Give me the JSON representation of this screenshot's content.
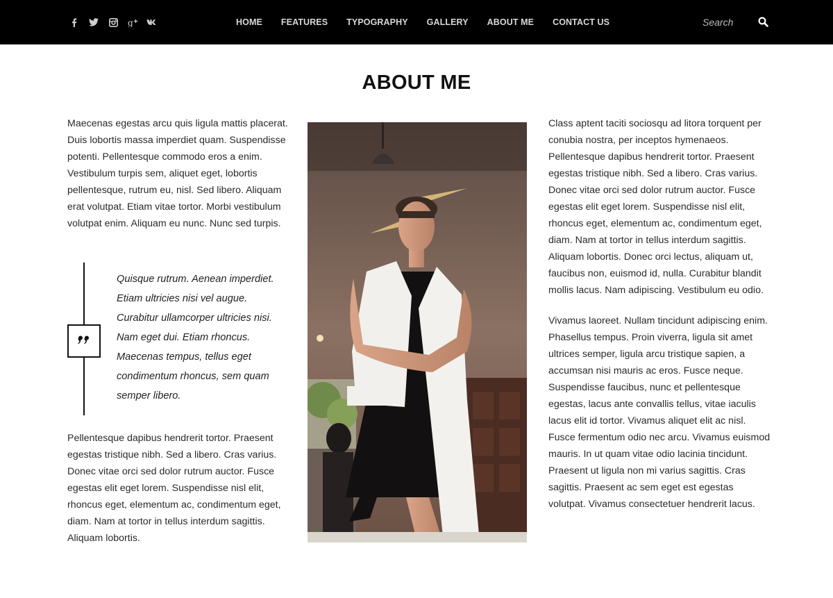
{
  "header": {
    "social": [
      {
        "name": "facebook-icon"
      },
      {
        "name": "twitter-icon"
      },
      {
        "name": "instagram-icon"
      },
      {
        "name": "google-plus-icon"
      },
      {
        "name": "vk-icon"
      }
    ],
    "nav": [
      {
        "label": "HOME"
      },
      {
        "label": "FEATURES"
      },
      {
        "label": "TYPOGRAPHY"
      },
      {
        "label": "GALLERY"
      },
      {
        "label": "ABOUT ME"
      },
      {
        "label": "CONTACT US"
      }
    ],
    "search": {
      "placeholder": "Search",
      "icon": "search-icon"
    }
  },
  "page": {
    "title": "ABOUT ME",
    "left_paragraph_1": "Maecenas egestas arcu quis ligula mattis placerat. Duis lobortis massa imperdiet quam. Suspendisse potenti. Pellentesque commodo eros a enim. Vestibulum turpis sem, aliquet eget, lobortis pellentesque, rutrum eu, nisl. Sed libero. Aliquam erat volutpat. Etiam vitae tortor. Morbi vestibulum volutpat enim. Aliquam eu nunc. Nunc sed turpis.",
    "quote": "Quisque rutrum. Aenean imperdiet. Etiam ultricies nisi vel augue. Curabitur ullamcorper ultricies nisi. Nam eget dui. Etiam rhoncus. Maecenas tempus, tellus eget condimentum rhoncus, sem quam semper libero.",
    "left_paragraph_2": "Pellentesque dapibus hendrerit tortor. Praesent egestas tristique nibh. Sed a libero. Cras varius. Donec vitae orci sed dolor rutrum auctor. Fusce egestas elit eget lorem. Suspendisse nisl elit, rhoncus eget, elementum ac, condimentum eget, diam. Nam at tortor in tellus interdum sagittis. Aliquam lobortis.",
    "right_paragraph_1": "Class aptent taciti sociosqu ad litora torquent per conubia nostra, per inceptos hymenaeos. Pellentesque dapibus hendrerit tortor. Praesent egestas tristique nibh. Sed a libero. Cras varius. Donec vitae orci sed dolor rutrum auctor. Fusce egestas elit eget lorem. Suspendisse nisl elit, rhoncus eget, elementum ac, condimentum eget, diam. Nam at tortor in tellus interdum sagittis. Aliquam lobortis. Donec orci lectus, aliquam ut, faucibus non, euismod id, nulla. Curabitur blandit mollis lacus. Nam adipiscing. Vestibulum eu odio.",
    "right_paragraph_2": "Vivamus laoreet. Nullam tincidunt adipiscing enim. Phasellus tempus. Proin viverra, ligula sit amet ultrices semper, ligula arcu tristique sapien, a accumsan nisi mauris ac eros. Fusce neque. Suspendisse faucibus, nunc et pellentesque egestas, lacus ante convallis tellus, vitae iaculis lacus elit id tortor. Vivamus aliquet elit ac nisl. Fusce fermentum odio nec arcu. Vivamus euismod mauris. In ut quam vitae odio lacinia tincidunt. Praesent ut ligula non mi varius sagittis. Cras sagittis. Praesent ac sem eget est egestas volutpat. Vivamus consectetuer hendrerit lacus."
  },
  "colors": {
    "header_bg": "#000000",
    "nav_text": "#d8d8d8",
    "body_text": "#2a2a2a",
    "title": "#111111"
  }
}
